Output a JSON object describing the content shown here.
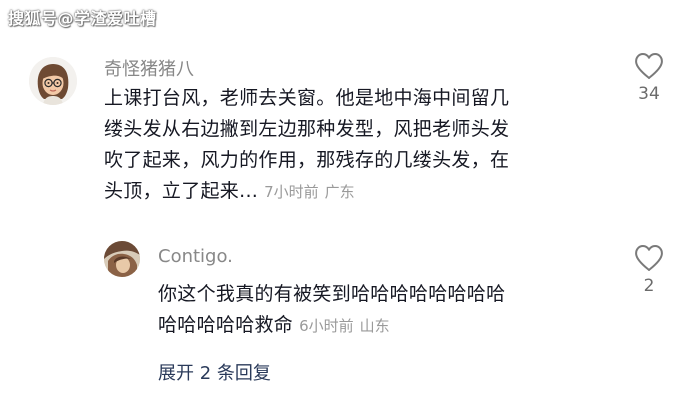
{
  "watermark": "搜狐号@学渣爱吐槽",
  "comment": {
    "username": "奇怪猪猪八",
    "lines": [
      "上课打台风，老师去关窗。他是地中海中间留几",
      "缕头发从右边撇到左边那种发型，风把老师头发",
      "吹了起来，风力的作用，那残存的几缕头发，在",
      "头顶，立了起来..."
    ],
    "time": "7小时前",
    "location": "广东",
    "likes": "34",
    "avatar_icon": "memoji-avatar-icon"
  },
  "reply": {
    "username": "Contigo.",
    "lines": [
      "你这个我真的有被笑到哈哈哈哈哈哈哈哈",
      "哈哈哈哈哈救命"
    ],
    "time": "6小时前",
    "location": "山东",
    "likes": "2",
    "avatar_icon": "photo-avatar-icon"
  },
  "expand_label": "展开 2 条回复",
  "colors": {
    "text": "#161823",
    "secondary": "#888888",
    "meta": "#9a9a9a",
    "link": "#2a3a5a"
  }
}
